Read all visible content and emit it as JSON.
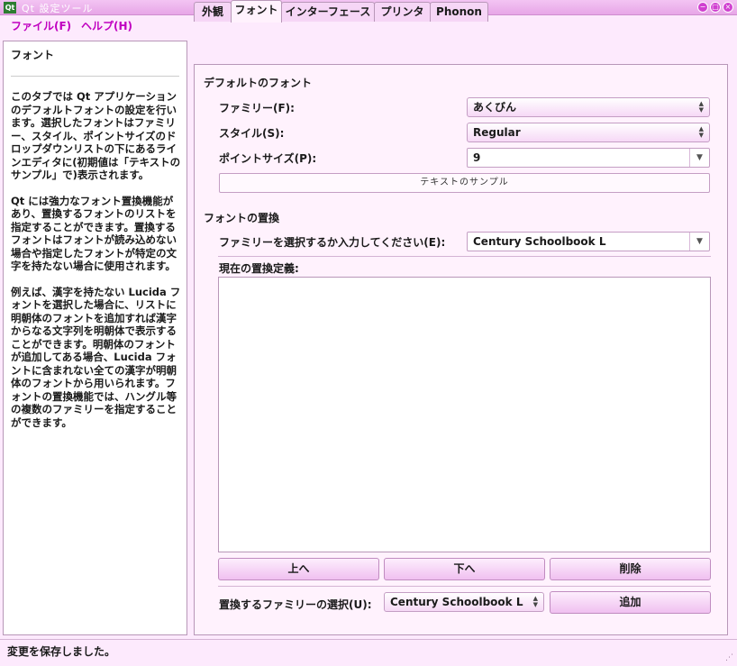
{
  "window": {
    "title": "Qt 設定ツール",
    "app_icon": "Qt"
  },
  "menu": {
    "file": "ファイル(F)",
    "help": "ヘルプ(H)"
  },
  "left_panel": {
    "title": "フォント",
    "paragraphs": [
      "このタブでは Qt アプリケーションのデフォルトフォントの設定を行います。選択したフォントはファミリー、スタイル、ポイントサイズのドロップダウンリストの下にあるラインエディタに(初期値は「テキストのサンプル」で)表示されます。",
      "Qt には強力なフォント置換機能があり、置換するフォントのリストを指定することができます。置換するフォントはフォントが読み込めない場合や指定したフォントが特定の文字を持たない場合に使用されます。",
      "例えば、漢字を持たない Lucida フォントを選択した場合に、リストに明朝体のフォントを追加すれば漢字からなる文字列を明朝体で表示することができます。明朝体のフォントが追加してある場合、Lucida フォントに含まれない全ての漢字が明朝体のフォントから用いられます。フォントの置換機能では、ハングル等の複数のファミリーを指定することができます。"
    ]
  },
  "tabs": [
    "外観",
    "フォント",
    "インターフェース",
    "プリンタ",
    "Phonon"
  ],
  "default_font": {
    "group_title": "デフォルトのフォント",
    "family_label": "ファミリー(F):",
    "family_value": "あくびん",
    "style_label": "スタイル(S):",
    "style_value": "Regular",
    "size_label": "ポイントサイズ(P):",
    "size_value": "9",
    "sample_text": "テキストのサンプル"
  },
  "substitution": {
    "group_title": "フォントの置換",
    "select_label": "ファミリーを選択するか入力してください(E):",
    "select_value": "Century Schoolbook L",
    "current_label": "現在の置換定義:",
    "up_button": "上へ",
    "down_button": "下へ",
    "delete_button": "削除",
    "replace_label": "置換するファミリーの選択(U):",
    "replace_value": "Century Schoolbook L",
    "add_button": "追加"
  },
  "status": "変更を保存しました。"
}
